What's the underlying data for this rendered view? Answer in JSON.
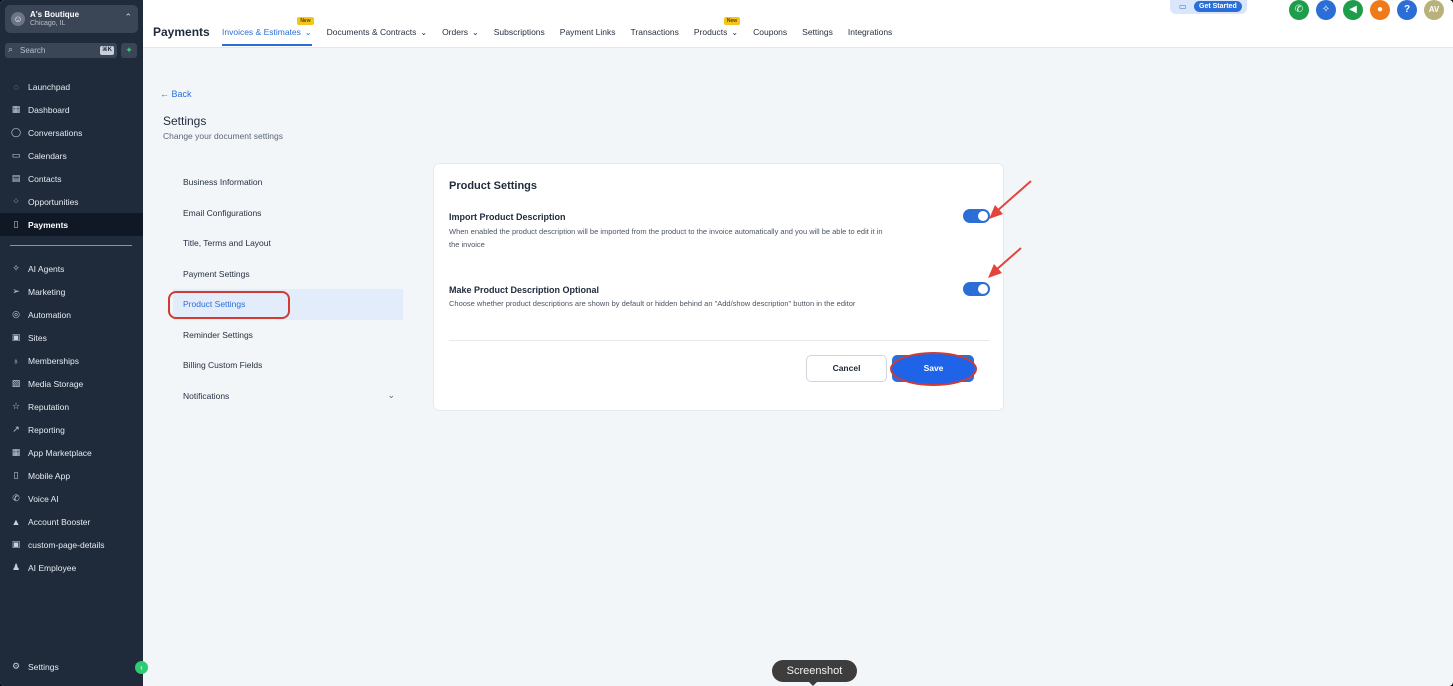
{
  "account": {
    "name": "A's Boutique",
    "location": "Chicago, IL"
  },
  "search": {
    "placeholder": "Search",
    "shortcut": "⌘K"
  },
  "sidebar": {
    "items": [
      {
        "label": "Launchpad",
        "icon": "rocket-icon",
        "glyph": "◌"
      },
      {
        "label": "Dashboard",
        "icon": "grid-icon",
        "glyph": "▦"
      },
      {
        "label": "Conversations",
        "icon": "chat-icon",
        "glyph": "◯"
      },
      {
        "label": "Calendars",
        "icon": "calendar-icon",
        "glyph": "▭"
      },
      {
        "label": "Contacts",
        "icon": "contacts-icon",
        "glyph": "▤"
      },
      {
        "label": "Opportunities",
        "icon": "opportunities-icon",
        "glyph": "⁘"
      },
      {
        "label": "Payments",
        "icon": "receipt-icon",
        "glyph": "▯"
      }
    ],
    "items2": [
      {
        "label": "AI Agents",
        "icon": "sparkle-icon",
        "glyph": "✧"
      },
      {
        "label": "Marketing",
        "icon": "send-icon",
        "glyph": "➢"
      },
      {
        "label": "Automation",
        "icon": "automation-icon",
        "glyph": "◎"
      },
      {
        "label": "Sites",
        "icon": "sites-icon",
        "glyph": "▣"
      },
      {
        "label": "Memberships",
        "icon": "membership-icon",
        "glyph": "♁"
      },
      {
        "label": "Media Storage",
        "icon": "image-icon",
        "glyph": "▨"
      },
      {
        "label": "Reputation",
        "icon": "star-icon",
        "glyph": "☆"
      },
      {
        "label": "Reporting",
        "icon": "trend-icon",
        "glyph": "↗"
      },
      {
        "label": "App Marketplace",
        "icon": "apps-icon",
        "glyph": "▦"
      },
      {
        "label": "Mobile App",
        "icon": "mobile-icon",
        "glyph": "▯"
      },
      {
        "label": "Voice AI",
        "icon": "phone-icon",
        "glyph": "✆"
      },
      {
        "label": "Account Booster",
        "icon": "booster-icon",
        "glyph": "▲"
      },
      {
        "label": "custom-page-details",
        "icon": "page-icon",
        "glyph": "▣"
      },
      {
        "label": "AI Employee",
        "icon": "person-icon",
        "glyph": "♟"
      }
    ],
    "settings_label": "Settings"
  },
  "topbar": {
    "title": "Payments",
    "tabs": [
      {
        "label": "Invoices & Estimates",
        "badge": "New"
      },
      {
        "label": "Documents & Contracts"
      },
      {
        "label": "Orders"
      },
      {
        "label": "Subscriptions"
      },
      {
        "label": "Payment Links"
      },
      {
        "label": "Transactions"
      },
      {
        "label": "Products",
        "badge": "New"
      },
      {
        "label": "Coupons"
      },
      {
        "label": "Settings"
      },
      {
        "label": "Integrations"
      }
    ],
    "get_started": "Get Started",
    "avatar_initials": "AV",
    "help": "?"
  },
  "page": {
    "back": "Back",
    "title": "Settings",
    "subtitle": "Change your document settings"
  },
  "settings_nav": [
    "Business Information",
    "Email Configurations",
    "Title, Terms and Layout",
    "Payment Settings",
    "Product Settings",
    "Reminder Settings",
    "Billing Custom Fields",
    "Notifications"
  ],
  "card": {
    "title": "Product Settings",
    "opt1_title": "Import Product Description",
    "opt1_desc": "When enabled the product description will be imported from the product to the invoice automatically and you will be able to edit it in the invoice",
    "opt2_title": "Make Product Description Optional",
    "opt2_desc": "Choose whether product descriptions are shown by default or hidden behind an \"Add/show description\" button in the editor",
    "cancel": "Cancel",
    "save": "Save"
  },
  "tooltip": "Screenshot",
  "colors": {
    "accent": "#2b6fd6",
    "sidebar": "#1f2a3a",
    "annotation": "#d13b33"
  }
}
